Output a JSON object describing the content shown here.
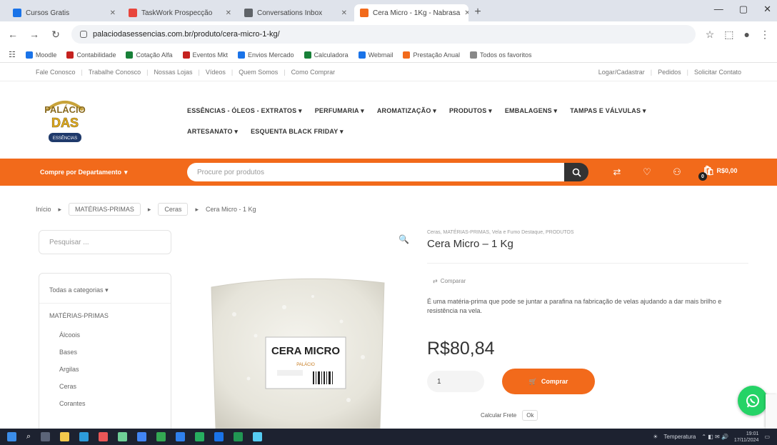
{
  "browser": {
    "tabs": [
      {
        "title": "Cursos Gratis",
        "favicon_color": "#1a73e8",
        "active": false
      },
      {
        "title": "TaskWork Prospecção",
        "favicon_color": "#e8453c",
        "active": false
      },
      {
        "title": "Conversations Inbox",
        "favicon_color": "#5f6368",
        "active": false
      },
      {
        "title": "Cera Micro - 1Kg - Nabrasa",
        "favicon_color": "#f26a1b",
        "active": true
      }
    ],
    "new_tab": "+",
    "window_controls": [
      "—",
      "▢",
      "✕"
    ],
    "url": "palaciodasessencias.com.br/produto/cera-micro-1-kg/",
    "bookmarks": [
      {
        "label": "Moodle",
        "color": "#1a73e8"
      },
      {
        "label": "Contabilidade",
        "color": "#c5221f"
      },
      {
        "label": "Cotação Alfa",
        "color": "#188038"
      },
      {
        "label": "Eventos Mkt",
        "color": "#c5221f"
      },
      {
        "label": "Envios Mercado",
        "color": "#1a73e8"
      },
      {
        "label": "Calculadora",
        "color": "#188038"
      },
      {
        "label": "Webmail",
        "color": "#1a73e8"
      },
      {
        "label": "Prestação Anual",
        "color": "#f26a1b"
      },
      {
        "label": "Todos os favoritos",
        "color": "#888888"
      }
    ]
  },
  "site": {
    "top_links_left": [
      "Fale Conosco",
      "Trabalhe Conosco",
      "Nossas Lojas",
      "Vídeos",
      "Quem Somos",
      "Como Comprar"
    ],
    "top_links_right": [
      "Logar/Cadastrar",
      "Pedidos",
      "Solicitar Contato"
    ],
    "logo_text": [
      "PALÁCIO",
      "DAS",
      "ESSÊNCIAS"
    ],
    "menu_row1": [
      "ESSÊNCIAS - ÓLEOS - EXTRATOS",
      "PERFUMARIA",
      "AROMATIZAÇÃO",
      "PRODUTOS",
      "EMBALAGENS",
      "TAMPAS E VÁLVULAS"
    ],
    "menu_row2": [
      "ARTESANATO",
      "ESQUENTA BLACK FRIDAY"
    ],
    "dept_button": "Compre por Departamento",
    "search_placeholder": "Procure por produtos",
    "cart_total": "R$0,00",
    "cart_count": "0"
  },
  "breadcrumb": [
    "Início",
    "MATÉRIAS-PRIMAS",
    "Ceras",
    "Cera Micro - 1 Kg"
  ],
  "sidebar": {
    "search_placeholder": "Pesquisar ...",
    "all_categories": "Todas a categorias",
    "parent": "MATÉRIAS-PRIMAS",
    "children": [
      "Álcoois",
      "Bases",
      "Argilas",
      "Ceras",
      "Corantes"
    ]
  },
  "product": {
    "image_label": "CERA MICRO",
    "image_brand": "PALÁCIO",
    "categories": "Ceras, MATÉRIAS-PRIMAS, Vela e Fumo Destaque, PRODUTOS",
    "title": "Cera Micro – 1 Kg",
    "compare": "Comparar",
    "description": "É uma matéria-prima que pode se juntar a parafina na fabricação de velas ajudando a dar mais brilho e resistência na vela.",
    "price": "R$80,84",
    "qty": "1",
    "buy_button": "Comprar",
    "shipping_label": "Calcular Frete",
    "shipping_chip": "Ok"
  },
  "taskbar": {
    "weather": "Temperatura",
    "time": "19:01",
    "date": "17/11/2024",
    "colors": {
      "bar": "#1d2230",
      "accent": "#f26a1b"
    }
  }
}
